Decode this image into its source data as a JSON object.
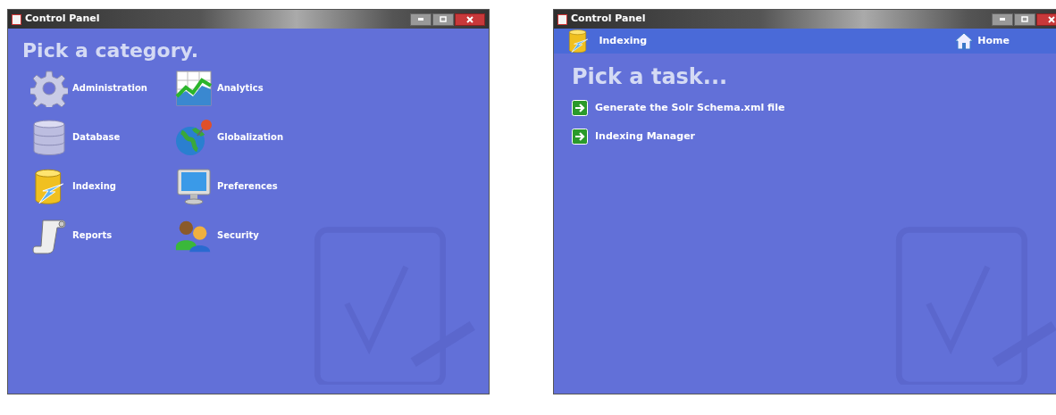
{
  "windows": [
    {
      "title": "Control Panel",
      "heading": "Pick a category.",
      "categories": [
        {
          "label": "Administration"
        },
        {
          "label": "Analytics"
        },
        {
          "label": "Database"
        },
        {
          "label": "Globalization"
        },
        {
          "label": "Indexing"
        },
        {
          "label": "Preferences"
        },
        {
          "label": "Reports"
        },
        {
          "label": "Security"
        }
      ]
    },
    {
      "title": "Control Panel",
      "breadcrumb": "Indexing",
      "home": "Home",
      "heading": "Pick a task...",
      "tasks": [
        {
          "label": "Generate the Solr Schema.xml file"
        },
        {
          "label": "Indexing Manager"
        }
      ]
    }
  ]
}
